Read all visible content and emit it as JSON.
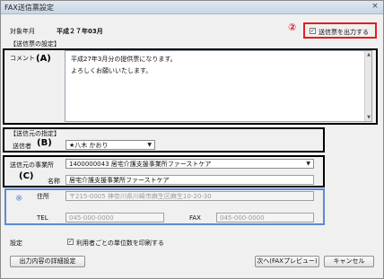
{
  "window": {
    "title": "FAX送信票設定",
    "close_label": "×"
  },
  "header": {
    "target_month_label": "対象年月",
    "target_month_value": "平成２７年03月",
    "output_checkbox_label": "送信票を出力する",
    "output_checked": "✓",
    "annotation": "②"
  },
  "settings_section": {
    "heading": "【送信票の設定】",
    "comment_label": "コメント",
    "annotation": "(A)",
    "comment_line1": "平成27年3月分の提供票になります。",
    "comment_line2": "よろしくお願いいたします。"
  },
  "sender_section": {
    "heading": "【送信元の指定】",
    "sender_label": "送信者",
    "annotation": "(B)",
    "sender_value": "★八木 かおり"
  },
  "office_section": {
    "office_label": "送信元の事業所",
    "office_value": "1400000043 居宅介護支援事業所ファーストケア",
    "name_label": "名称",
    "name_value": "居宅介護支援事業所ファーストケア",
    "annotation": "(C)"
  },
  "address_section": {
    "marker": "※",
    "address_label": "住所",
    "address_value": "〒215-0005 神奈川県川崎市麻生区麻生10-20-30",
    "tel_label": "TEL",
    "tel_value": "045-000-0000",
    "fax_label": "FAX",
    "fax_value": "045-000-0000"
  },
  "footer": {
    "settings_label": "設定",
    "print_checkbox_label": "利用者ごとの単位数を印刷する",
    "print_checked": "✓",
    "detail_button": "出力内容の詳細設定",
    "next_button": "次へ(FAXプレビュー)",
    "cancel_button": "キャンセル"
  },
  "colors": {
    "highlight_red": "#e02020",
    "highlight_blue": "#5b8bd0"
  }
}
